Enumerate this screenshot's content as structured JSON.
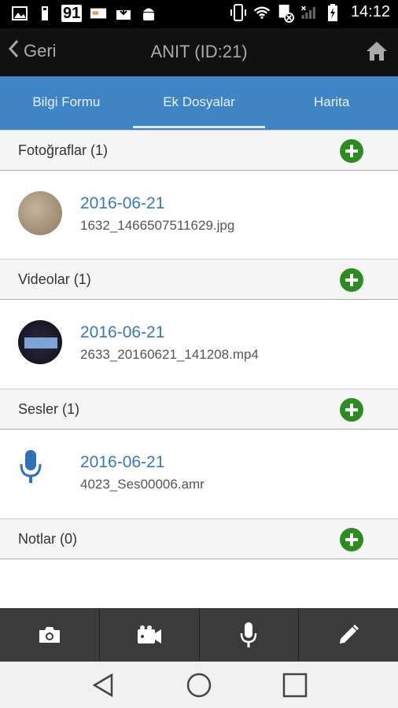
{
  "status_bar": {
    "badge_number": "91",
    "time": "14:12"
  },
  "header": {
    "back_label": "Geri",
    "title": "ANIT (ID:21)"
  },
  "tabs": [
    {
      "label": "Bilgi Formu",
      "active": false
    },
    {
      "label": "Ek Dosyalar",
      "active": true
    },
    {
      "label": "Harita",
      "active": false
    }
  ],
  "sections": {
    "photos": {
      "title": "Fotoğraflar (1)",
      "items": [
        {
          "date": "2016-06-21",
          "filename": "1632_1466507511629.jpg"
        }
      ]
    },
    "videos": {
      "title": "Videolar (1)",
      "items": [
        {
          "date": "2016-06-21",
          "filename": "2633_20160621_141208.mp4"
        }
      ]
    },
    "sounds": {
      "title": "Sesler (1)",
      "items": [
        {
          "date": "2016-06-21",
          "filename": "4023_Ses00006.amr"
        }
      ]
    },
    "notes": {
      "title": "Notlar (0)",
      "items": []
    }
  },
  "bottom_actions": [
    "camera-icon",
    "video-camera-icon",
    "microphone-icon",
    "pencil-icon"
  ],
  "colors": {
    "accent_blue": "#3f85c6",
    "add_green": "#2e8b23",
    "date_blue": "#3a78b8"
  }
}
